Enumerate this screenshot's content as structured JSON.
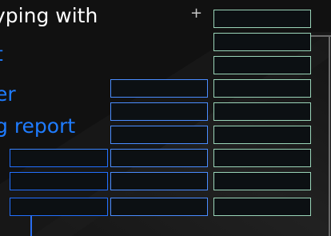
{
  "headline": {
    "line1": "ypin​g with",
    "line2": "t",
    "line3": "er",
    "line4": "g report"
  },
  "add_icon_glyph": "+",
  "colors": {
    "background": "#111111",
    "headline_white": "#ffffff",
    "headline_blue": "#1f7cff",
    "green_outline": "#9ad4b8",
    "blue_outline": "#2270ff"
  },
  "grid": {
    "green_column_rows": 8,
    "blue_middle_column_rows": 6,
    "blue_left_column_rows": 3
  }
}
